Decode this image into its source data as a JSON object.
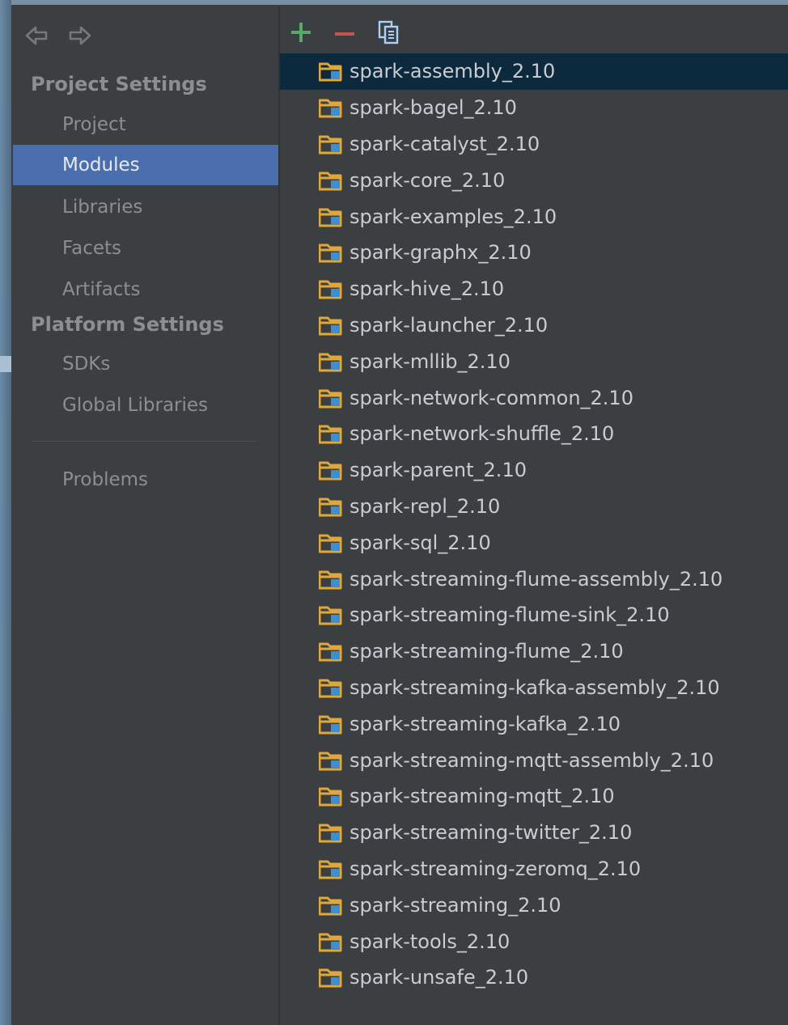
{
  "sidebar": {
    "nav_icons": [
      "back-arrow-icon",
      "forward-arrow-icon"
    ],
    "project_settings_header": "Project Settings",
    "project_settings_items": [
      "Project",
      "Modules",
      "Libraries",
      "Facets",
      "Artifacts"
    ],
    "platform_settings_header": "Platform Settings",
    "platform_settings_items": [
      "SDKs",
      "Global Libraries"
    ],
    "other_items": [
      "Problems"
    ],
    "selected_item": "Modules"
  },
  "toolbar": {
    "icons": [
      "add-icon",
      "remove-icon",
      "copy-icon"
    ]
  },
  "modules": {
    "selected_index": 0,
    "items": [
      "spark-assembly_2.10",
      "spark-bagel_2.10",
      "spark-catalyst_2.10",
      "spark-core_2.10",
      "spark-examples_2.10",
      "spark-graphx_2.10",
      "spark-hive_2.10",
      "spark-launcher_2.10",
      "spark-mllib_2.10",
      "spark-network-common_2.10",
      "spark-network-shuffle_2.10",
      "spark-parent_2.10",
      "spark-repl_2.10",
      "spark-sql_2.10",
      "spark-streaming-flume-assembly_2.10",
      "spark-streaming-flume-sink_2.10",
      "spark-streaming-flume_2.10",
      "spark-streaming-kafka-assembly_2.10",
      "spark-streaming-kafka_2.10",
      "spark-streaming-mqtt-assembly_2.10",
      "spark-streaming-mqtt_2.10",
      "spark-streaming-twitter_2.10",
      "spark-streaming-zeromq_2.10",
      "spark-streaming_2.10",
      "spark-tools_2.10",
      "spark-unsafe_2.10"
    ]
  },
  "colors": {
    "panel_background": "#3c3f41",
    "selection_sidebar": "#4b6eaf",
    "selection_list": "#0d293e",
    "add_green": "#59a869",
    "remove_red": "#c75450",
    "folder_orange": "#e0a83a",
    "module_blue": "#3d8fd1"
  }
}
